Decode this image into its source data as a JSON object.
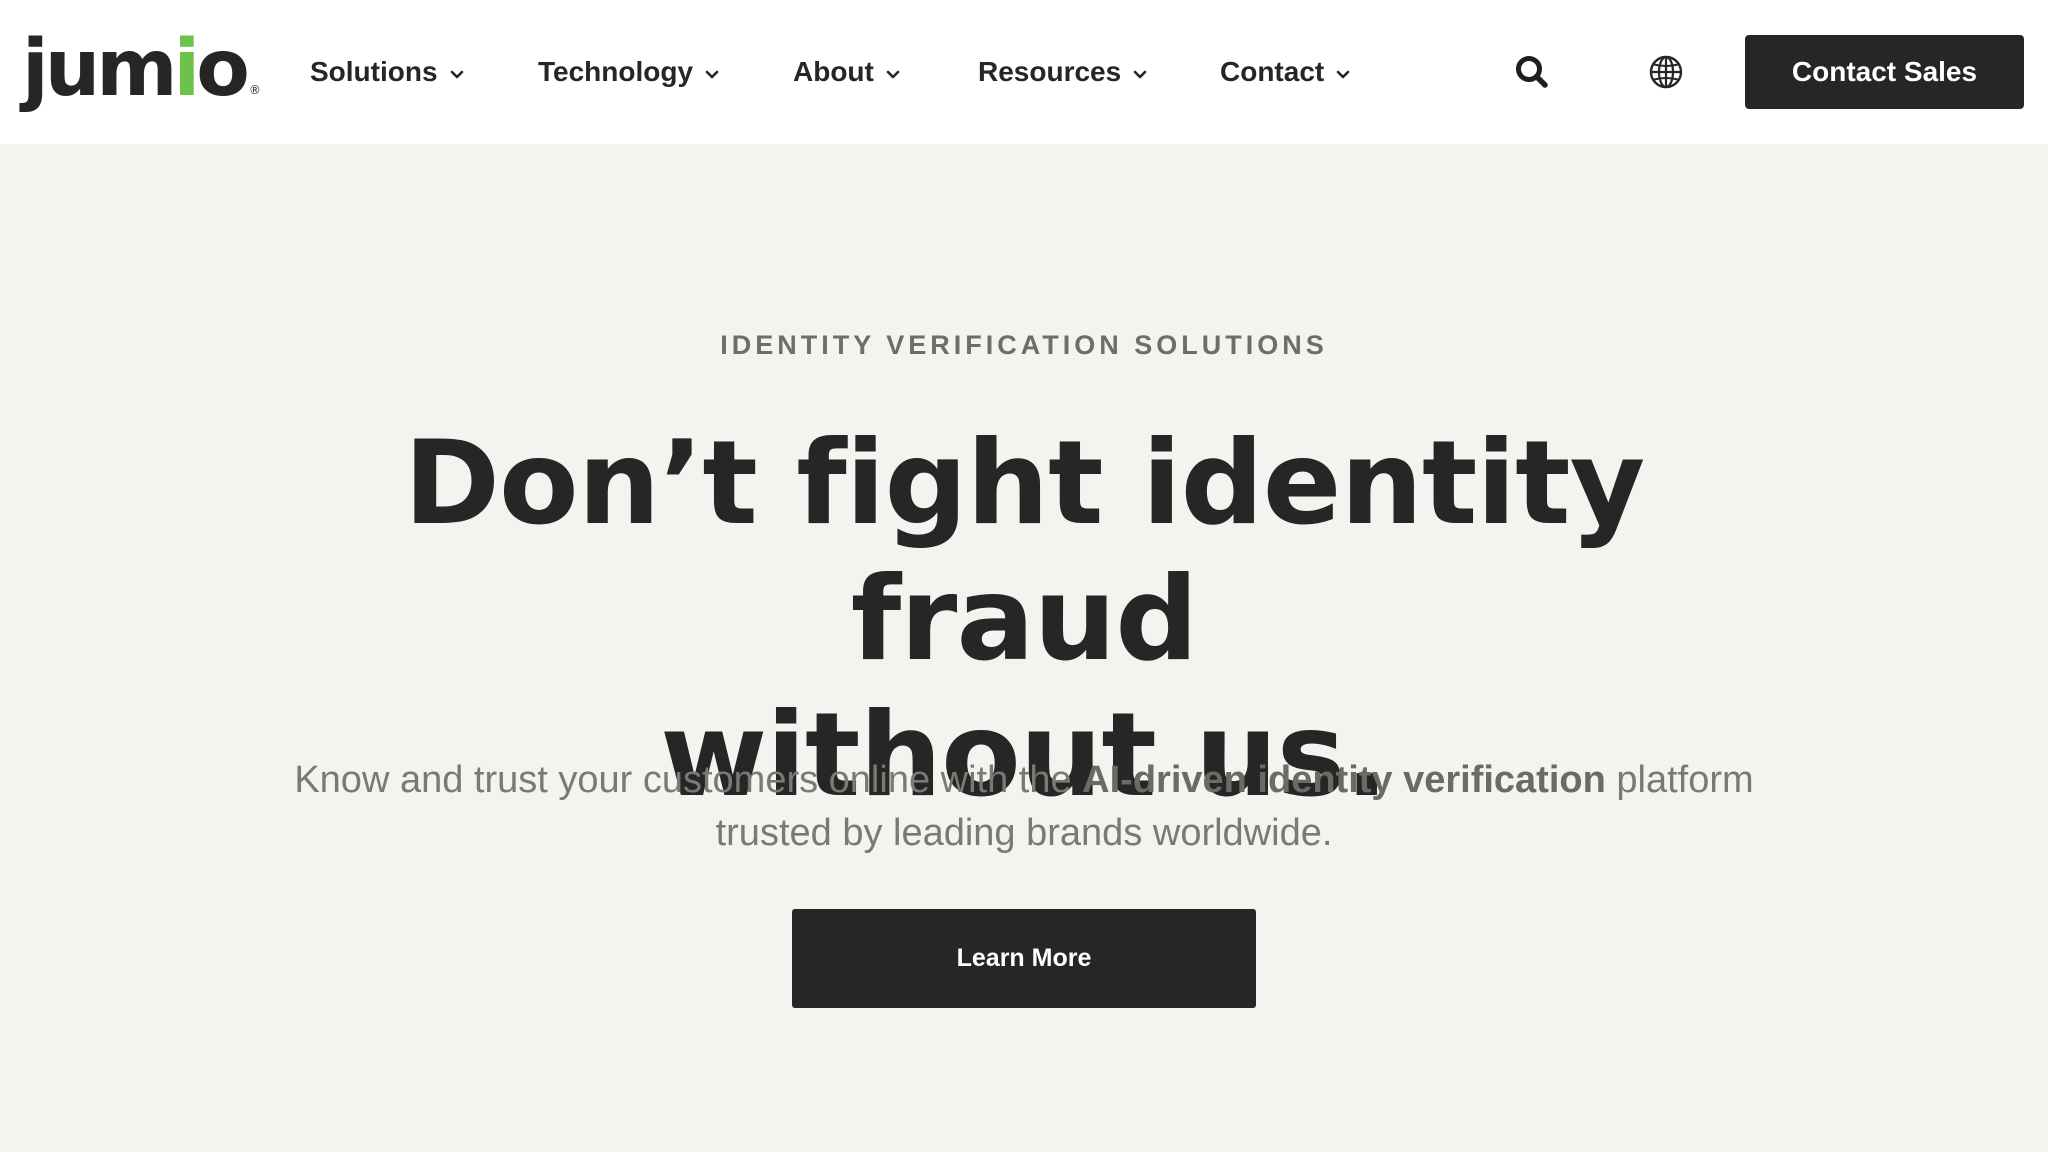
{
  "header": {
    "logo": {
      "text_main": "jum",
      "text_accent": "i",
      "text_end": "o",
      "registered_mark": "®"
    },
    "nav": [
      {
        "label": "Solutions",
        "icon": "chevron-down-icon"
      },
      {
        "label": "Technology",
        "icon": "chevron-down-icon"
      },
      {
        "label": "About",
        "icon": "chevron-down-icon"
      },
      {
        "label": "Resources",
        "icon": "chevron-down-icon"
      },
      {
        "label": "Contact",
        "icon": "chevron-down-icon"
      }
    ],
    "search_icon": "search-icon",
    "globe_icon": "globe-icon",
    "cta_label": "Contact Sales"
  },
  "hero": {
    "eyebrow": "IDENTITY VERIFICATION SOLUTIONS",
    "headline_line1": "Don’t fight identity fraud",
    "headline_line2": "without us.",
    "subtext_before": "Know and trust your customers online with the ",
    "subtext_emphasis": "AI-driven identity verification",
    "subtext_after": " platform trusted by leading brands worldwide.",
    "cta_label": "Learn More"
  },
  "colors": {
    "brand_dark": "#262626",
    "brand_green": "#6cc24a",
    "hero_background": "#f3f3ef",
    "header_background": "#ffffff",
    "muted_text": "#7a7a75"
  }
}
